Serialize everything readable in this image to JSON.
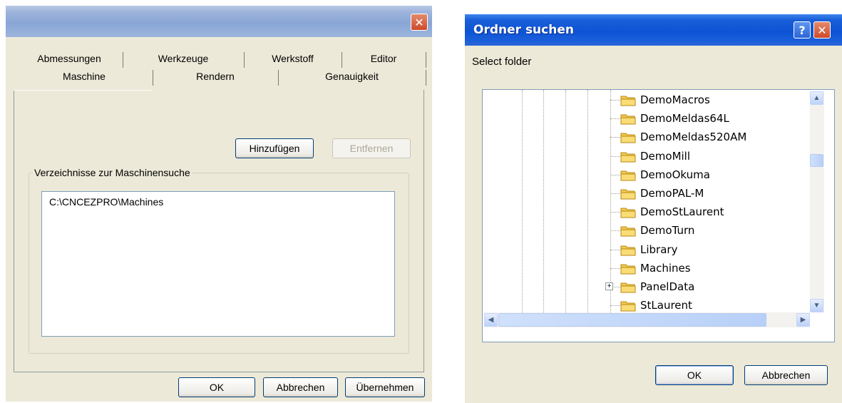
{
  "dialog1": {
    "close_glyph": "✕",
    "tabs_row1": [
      "Abmessungen",
      "Werkzeuge",
      "Werkstoff",
      "Editor"
    ],
    "tabs_row2": [
      "Maschine",
      "Rendern",
      "Genauigkeit"
    ],
    "add_button": "Hinzufügen",
    "remove_button": "Entfernen",
    "group_label": "Verzeichnisse zur Maschinensuche",
    "list_items": [
      "C:\\CNCEZPRO\\Machines"
    ],
    "ok_button": "OK",
    "cancel_button": "Abbrechen",
    "apply_button": "Übernehmen"
  },
  "dialog2": {
    "title": "Ordner suchen",
    "help_glyph": "?",
    "close_glyph": "✕",
    "prompt": "Select folder",
    "folders": [
      "DemoMacros",
      "DemoMeldas64L",
      "DemoMeldas520AM",
      "DemoMill",
      "DemoOkuma",
      "DemoPAL-M",
      "DemoStLaurent",
      "DemoTurn",
      "Library",
      "Machines",
      "PanelData",
      "StLaurent"
    ],
    "selected_folder": "Machines",
    "expandable_folder": "PanelData",
    "ok_button": "OK",
    "cancel_button": "Abbrechen"
  },
  "colors": {
    "dialog_bg": "#ece9d8",
    "title_active": "#0d53d4",
    "title_inactive": "#9db4dc",
    "close_red": "#cf4a2a"
  }
}
